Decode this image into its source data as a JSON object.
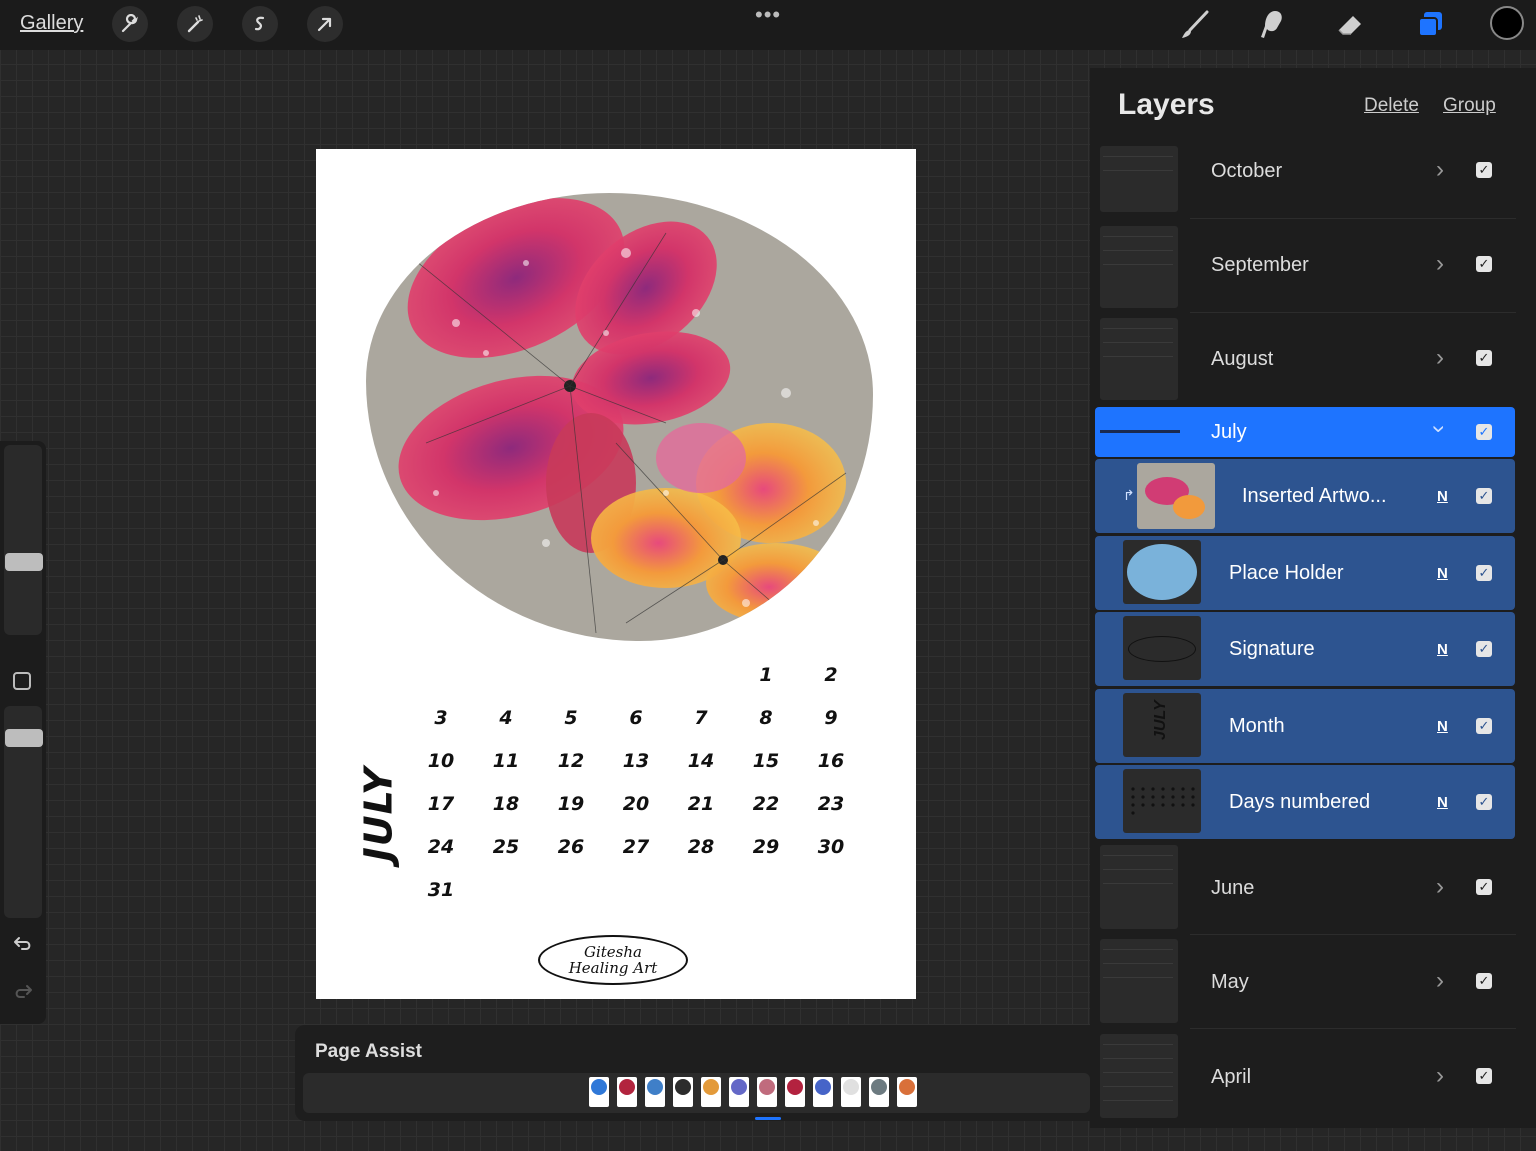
{
  "topbar": {
    "gallery_label": "Gallery",
    "tools_left": [
      "wrench-icon",
      "magic-wand-icon",
      "selection-icon",
      "transform-arrow-icon"
    ],
    "more_label": "•••",
    "tools_right": [
      "brush-icon",
      "smudge-icon",
      "eraser-icon",
      "layers-icon"
    ],
    "active_color": "#000000",
    "accent_color": "#1e74ff"
  },
  "canvas": {
    "month_label": "JULY",
    "calendar_rows": [
      [
        "",
        "",
        "",
        "",
        "",
        "1",
        "2"
      ],
      [
        "3",
        "4",
        "5",
        "6",
        "7",
        "8",
        "9"
      ],
      [
        "10",
        "11",
        "12",
        "13",
        "14",
        "15",
        "16"
      ],
      [
        "17",
        "18",
        "19",
        "20",
        "21",
        "22",
        "23"
      ],
      [
        "24",
        "25",
        "26",
        "27",
        "28",
        "29",
        "30"
      ],
      [
        "31",
        "",
        "",
        "",
        "",
        "",
        ""
      ]
    ],
    "signature_line1": "Gitesha",
    "signature_line2": "Healing Art"
  },
  "page_assist": {
    "title": "Page Assist",
    "thumb_colors": [
      "#2f78d8",
      "#b2243e",
      "#3f7fc8",
      "#2c2c2c",
      "#e39a3a",
      "#6468c7",
      "#c06b7d",
      "#b3223f",
      "#4664c8",
      "#e0e0e0",
      "#6c7a80",
      "#d9703a"
    ]
  },
  "layers": {
    "title": "Layers",
    "delete_label": "Delete",
    "group_label": "Group",
    "groups_above": [
      {
        "name": "October",
        "visible": true
      },
      {
        "name": "September",
        "visible": true
      },
      {
        "name": "August",
        "visible": true
      }
    ],
    "selected_group": {
      "name": "July",
      "visible": true
    },
    "children": [
      {
        "name": "Inserted Artwo...",
        "blend": "N",
        "visible": true,
        "clipped": true
      },
      {
        "name": "Place Holder",
        "blend": "N",
        "visible": true
      },
      {
        "name": "Signature",
        "blend": "N",
        "visible": true
      },
      {
        "name": "Month",
        "blend": "N",
        "visible": true
      },
      {
        "name": "Days numbered",
        "blend": "N",
        "visible": true
      }
    ],
    "groups_below": [
      {
        "name": "June",
        "visible": true
      },
      {
        "name": "May",
        "visible": true
      },
      {
        "name": "April",
        "visible": true
      }
    ]
  }
}
